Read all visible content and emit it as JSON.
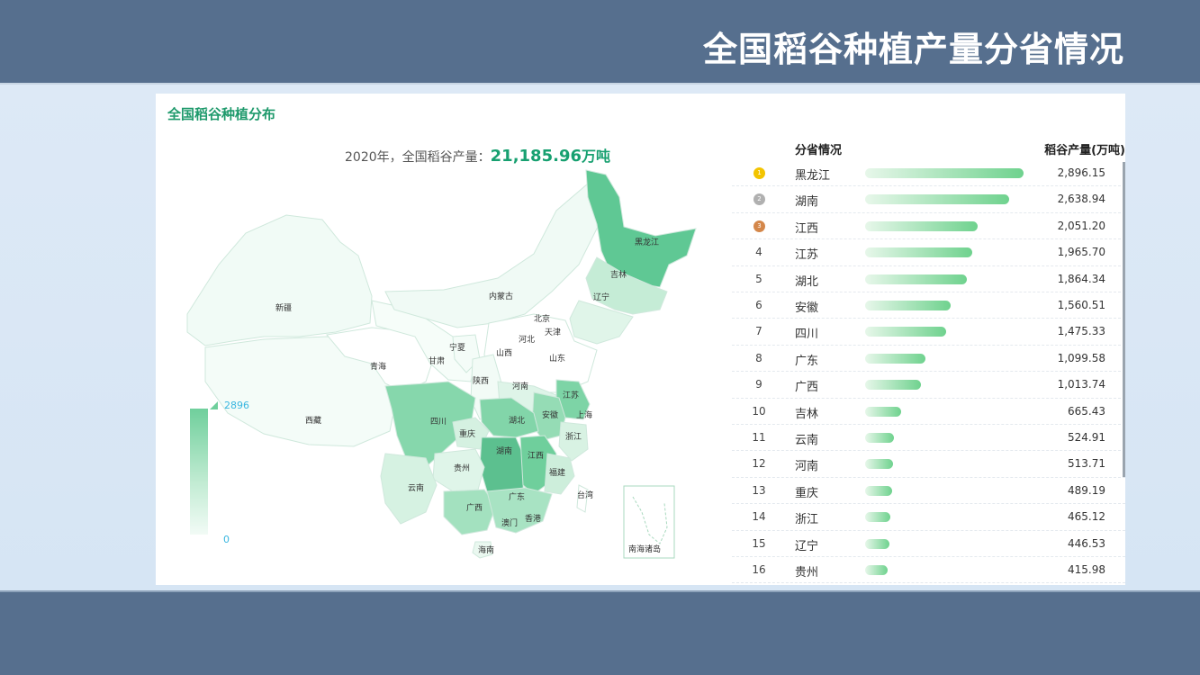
{
  "header": {
    "title": "全国稻谷种植产量分省情况"
  },
  "panel": {
    "title": "全国稻谷种植分布",
    "summary_prefix": "2020年，全国稻谷产量：",
    "summary_value": "21,185.96",
    "summary_unit": "万吨"
  },
  "legend": {
    "max": "2896",
    "min": "0",
    "color_high": "#6fcf9c",
    "color_low": "#f2fbf6"
  },
  "map_labels": [
    "黑龙江",
    "吉林",
    "辽宁",
    "内蒙古",
    "北京",
    "天津",
    "河北",
    "山西",
    "山东",
    "宁夏",
    "甘肃",
    "青海",
    "新疆",
    "西藏",
    "陕西",
    "河南",
    "江苏",
    "安徽",
    "上海",
    "湖北",
    "四川",
    "重庆",
    "浙江",
    "湖南",
    "江西",
    "贵州",
    "福建",
    "云南",
    "广东",
    "广西",
    "台湾",
    "香港",
    "澳门",
    "海南",
    "南海诸岛"
  ],
  "table": {
    "col_province": "分省情况",
    "col_value": "稻谷产量(万吨)",
    "max_value": 2896.15,
    "bar_color": "#6fd28e",
    "rows": [
      {
        "rank": "1",
        "medal": "gold",
        "province": "黑龙江",
        "value": 2896.15,
        "value_text": "2,896.15"
      },
      {
        "rank": "2",
        "medal": "silver",
        "province": "湖南",
        "value": 2638.94,
        "value_text": "2,638.94"
      },
      {
        "rank": "3",
        "medal": "bronze",
        "province": "江西",
        "value": 2051.2,
        "value_text": "2,051.20"
      },
      {
        "rank": "4",
        "medal": "",
        "province": "江苏",
        "value": 1965.7,
        "value_text": "1,965.70"
      },
      {
        "rank": "5",
        "medal": "",
        "province": "湖北",
        "value": 1864.34,
        "value_text": "1,864.34"
      },
      {
        "rank": "6",
        "medal": "",
        "province": "安徽",
        "value": 1560.51,
        "value_text": "1,560.51"
      },
      {
        "rank": "7",
        "medal": "",
        "province": "四川",
        "value": 1475.33,
        "value_text": "1,475.33"
      },
      {
        "rank": "8",
        "medal": "",
        "province": "广东",
        "value": 1099.58,
        "value_text": "1,099.58"
      },
      {
        "rank": "9",
        "medal": "",
        "province": "广西",
        "value": 1013.74,
        "value_text": "1,013.74"
      },
      {
        "rank": "10",
        "medal": "",
        "province": "吉林",
        "value": 665.43,
        "value_text": "665.43"
      },
      {
        "rank": "11",
        "medal": "",
        "province": "云南",
        "value": 524.91,
        "value_text": "524.91"
      },
      {
        "rank": "12",
        "medal": "",
        "province": "河南",
        "value": 513.71,
        "value_text": "513.71"
      },
      {
        "rank": "13",
        "medal": "",
        "province": "重庆",
        "value": 489.19,
        "value_text": "489.19"
      },
      {
        "rank": "14",
        "medal": "",
        "province": "浙江",
        "value": 465.12,
        "value_text": "465.12"
      },
      {
        "rank": "15",
        "medal": "",
        "province": "辽宁",
        "value": 446.53,
        "value_text": "446.53"
      },
      {
        "rank": "16",
        "medal": "",
        "province": "贵州",
        "value": 415.98,
        "value_text": "415.98"
      }
    ]
  }
}
